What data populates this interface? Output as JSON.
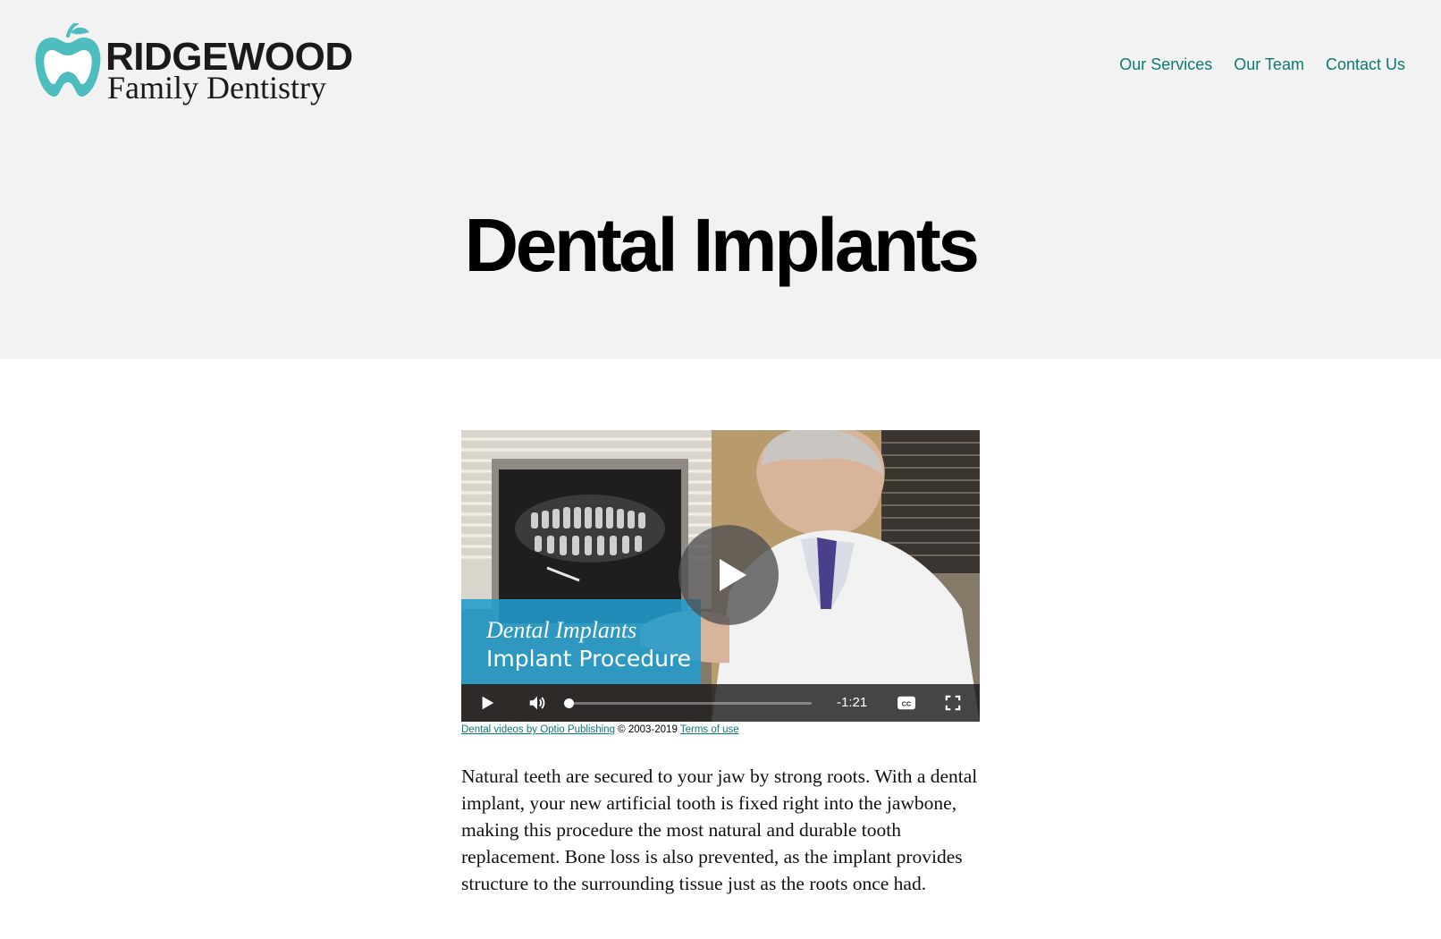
{
  "brand": {
    "name_line1": "RIDGEWOOD",
    "name_line2": "Family Dentistry",
    "accent": "#4dbdbf",
    "icon": "apple-tooth-logo-icon"
  },
  "nav": {
    "items": [
      {
        "label": "Our Services"
      },
      {
        "label": "Our Team"
      },
      {
        "label": "Contact Us"
      }
    ],
    "color": "#0a7a73"
  },
  "page": {
    "title": "Dental Implants"
  },
  "video": {
    "caption_title": "Dental Implants",
    "caption_subtitle": "Implant Procedure",
    "time_remaining": "-1:21",
    "progress": 0.0,
    "caption_color": "#229ccd",
    "icons": {
      "play_big": "play-icon",
      "play": "play-icon",
      "volume": "volume-icon",
      "cc": "closed-captions-icon",
      "fullscreen": "fullscreen-icon"
    }
  },
  "credits": {
    "link1": "Dental videos by Optio Publishing",
    "copyright": "© 2003-2019",
    "link2": "Terms of use"
  },
  "content": {
    "paragraph": "Natural teeth are secured to your jaw by strong roots. With a dental implant, your new artificial tooth is fixed right into the jawbone, making this procedure the most natural and durable tooth replacement. Bone loss is also prevented, as the implant provides structure to the surrounding tissue just as the roots once had."
  }
}
